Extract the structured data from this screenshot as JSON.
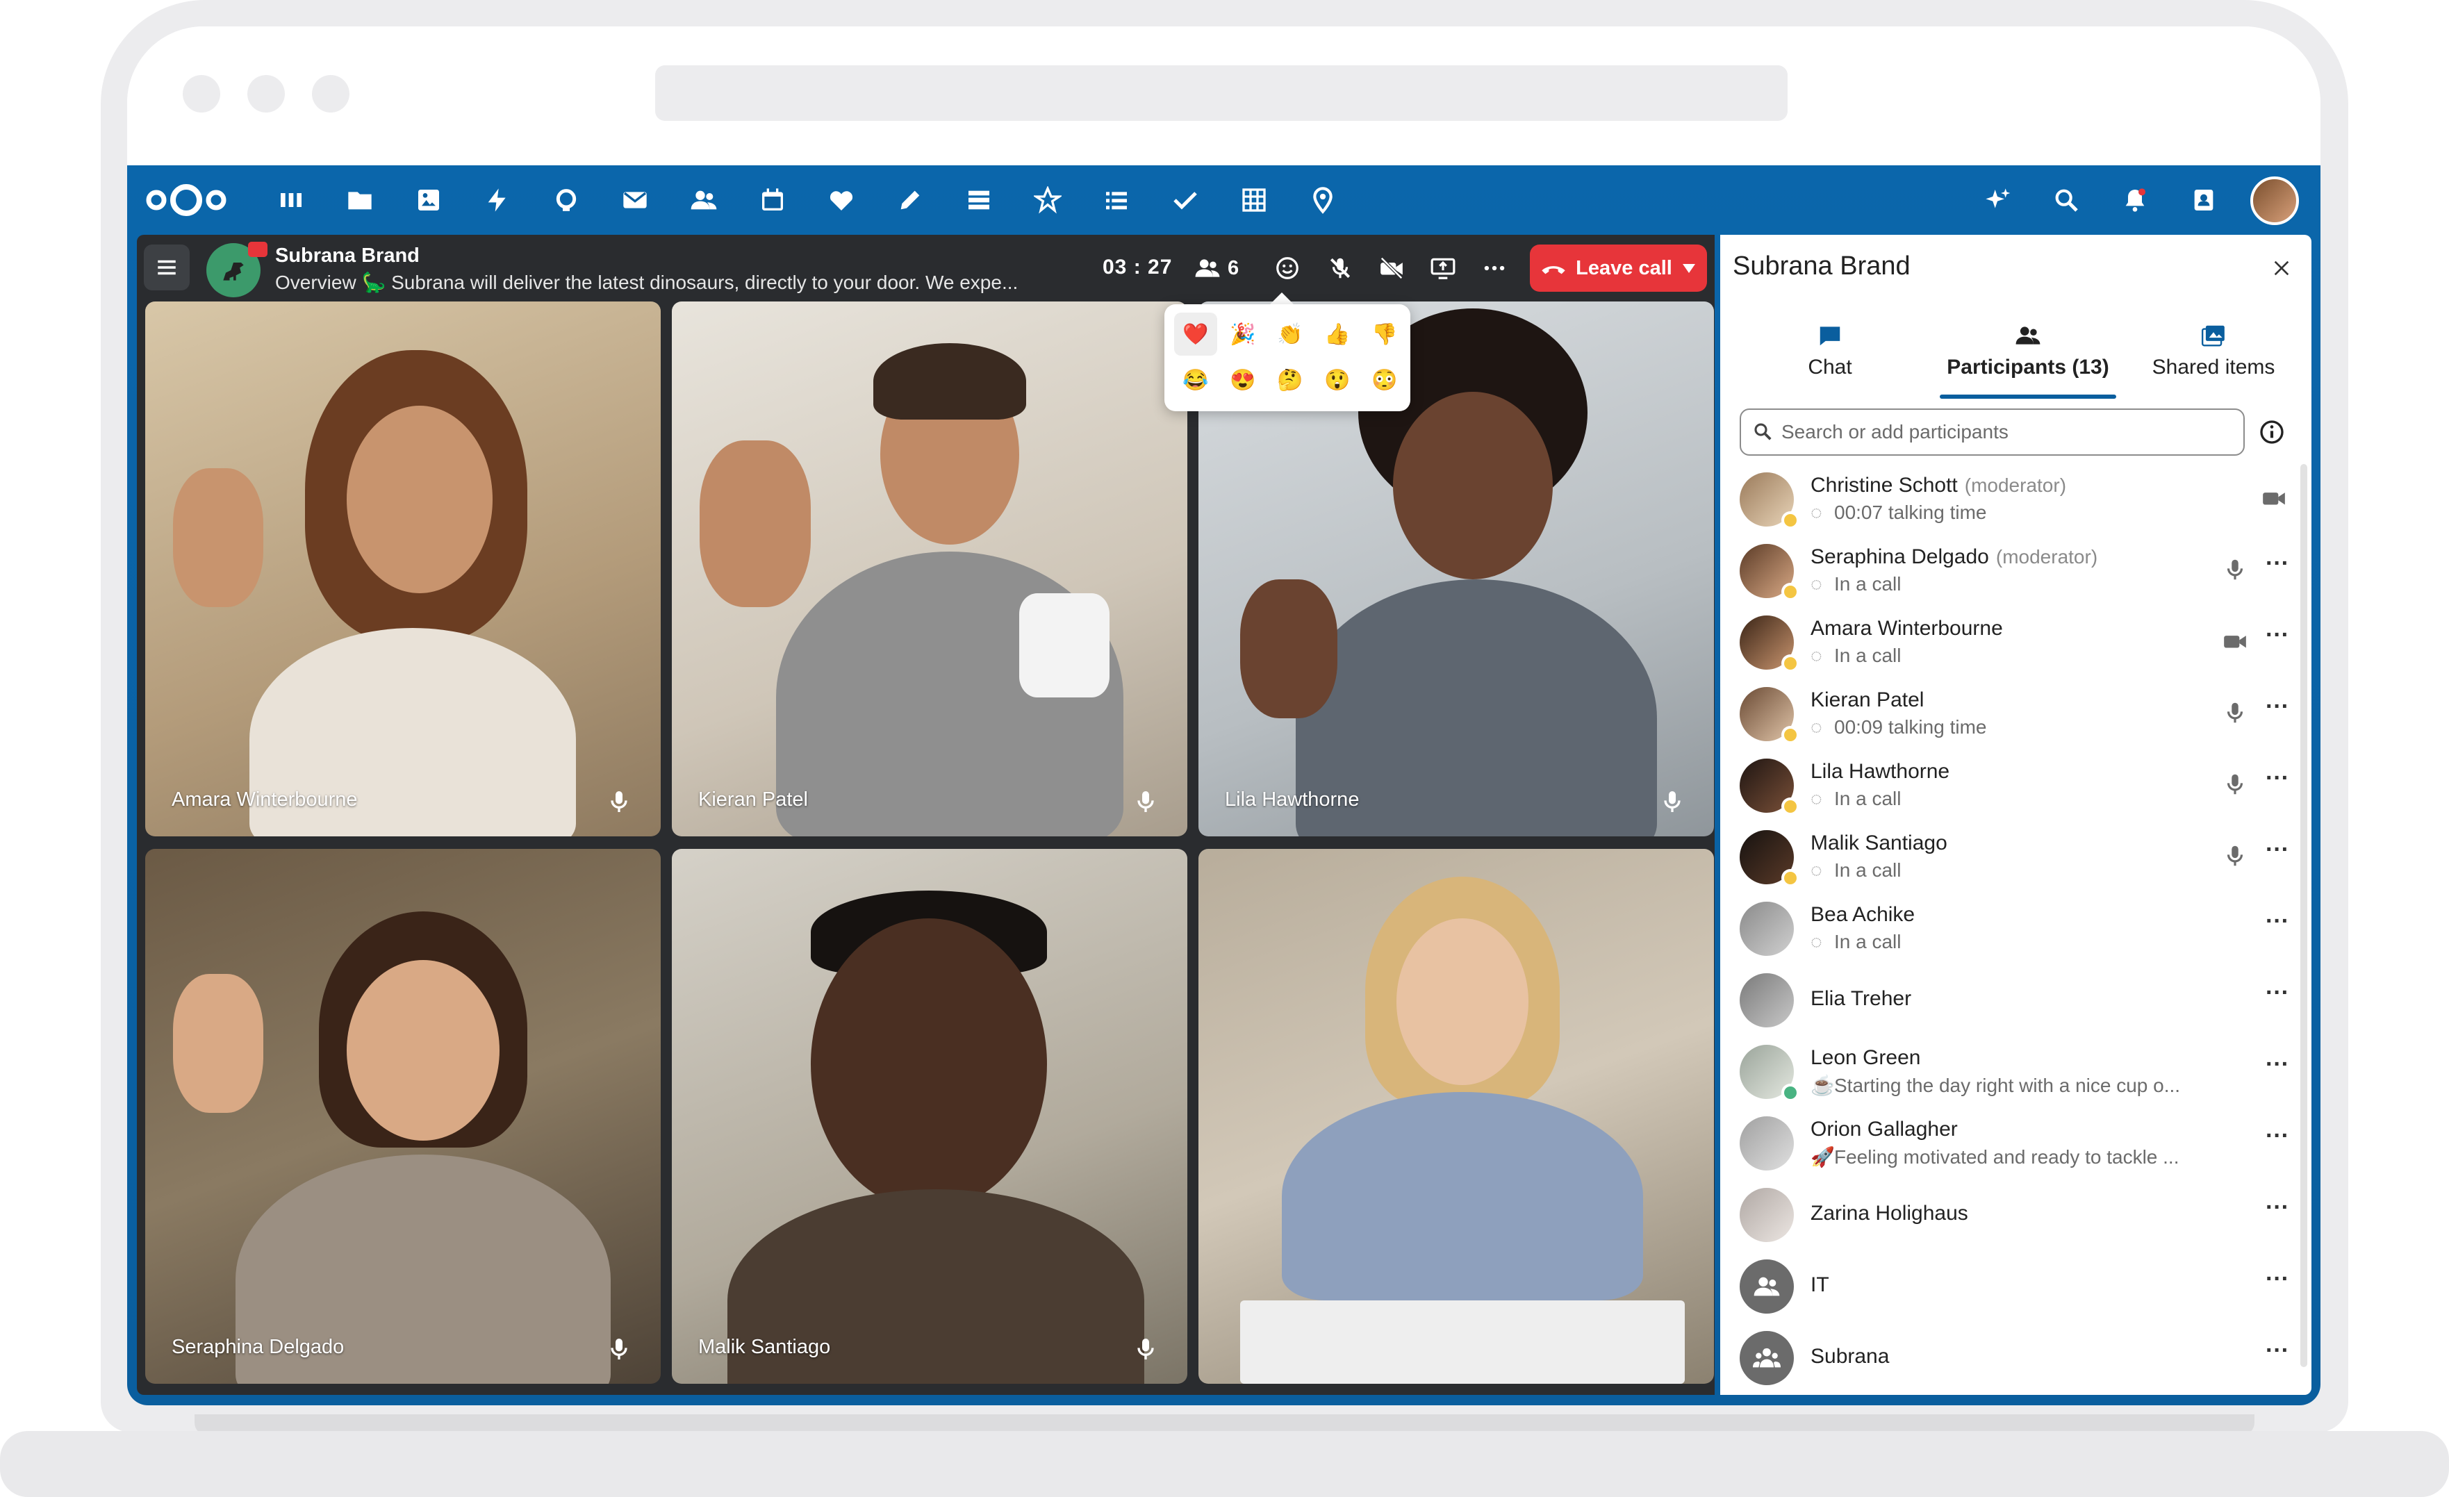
{
  "app": {
    "nav_icons": [
      "nextcloud-logo",
      "dashboard-icon",
      "files-icon",
      "photos-icon",
      "activity-icon",
      "talk-icon",
      "mail-icon",
      "contacts-icon",
      "calendar-icon",
      "favorites-icon",
      "notes-icon",
      "deck-icon",
      "tasks-icon",
      "list-icon",
      "checkmark-icon",
      "tables-icon",
      "maps-icon"
    ],
    "right_icons": [
      "assistant-icon",
      "search-icon",
      "notifications-icon",
      "contacts-menu-icon",
      "user-avatar"
    ]
  },
  "call": {
    "room_name": "Subrana Brand",
    "room_desc_label": "Overview",
    "room_desc": "Subrana will deliver the latest dinosaurs, directly to your door. We expe...",
    "timer": "03 : 27",
    "participant_count": "6",
    "leave_label": "Leave call",
    "reactions": [
      "❤️",
      "🎉",
      "👏",
      "👍",
      "👎",
      "😂",
      "😍",
      "🤔",
      "😲",
      "😳"
    ],
    "tiles": [
      {
        "name": "Amara Winterbourne"
      },
      {
        "name": "Kieran Patel"
      },
      {
        "name": "Lila Hawthorne"
      },
      {
        "name": "Seraphina Delgado"
      },
      {
        "name": "Malik Santiago"
      },
      {
        "name": ""
      }
    ]
  },
  "sidebar": {
    "title": "Subrana Brand",
    "tabs": [
      {
        "label": "Chat"
      },
      {
        "label": "Participants (13)"
      },
      {
        "label": "Shared items"
      }
    ],
    "search_placeholder": "Search or add participants",
    "participants": [
      {
        "name": "Christine Schott",
        "role": "(moderator)",
        "sub": "00:07 talking time",
        "media": "video"
      },
      {
        "name": "Seraphina Delgado",
        "role": "(moderator)",
        "sub": "In a call",
        "media": "mic"
      },
      {
        "name": "Amara Winterbourne",
        "role": "",
        "sub": "In a call",
        "media": "video"
      },
      {
        "name": "Kieran Patel",
        "role": "",
        "sub": "00:09 talking time",
        "media": "mic"
      },
      {
        "name": "Lila Hawthorne",
        "role": "",
        "sub": "In a call",
        "media": "mic"
      },
      {
        "name": "Malik Santiago",
        "role": "",
        "sub": "In a call",
        "media": "mic"
      },
      {
        "name": "Bea Achike",
        "role": "",
        "sub": "In a call",
        "media": ""
      },
      {
        "name": "Elia Treher",
        "role": "",
        "sub": "",
        "media": ""
      },
      {
        "name": "Leon Green",
        "role": "",
        "sub": "Starting the day right with a nice cup o...",
        "media": ""
      },
      {
        "name": "Orion Gallagher",
        "role": "",
        "sub": "Feeling motivated and ready to tackle ...",
        "media": ""
      },
      {
        "name": "Zarina Holighaus",
        "role": "",
        "sub": "",
        "media": ""
      },
      {
        "name": "IT",
        "role": "",
        "sub": "",
        "media": ""
      },
      {
        "name": "Subrana",
        "role": "",
        "sub": "",
        "media": ""
      }
    ]
  },
  "colors": {
    "brand_blue": "#0a5e9e",
    "leave_red": "#e7353a",
    "call_bg": "#2a2c2f"
  }
}
